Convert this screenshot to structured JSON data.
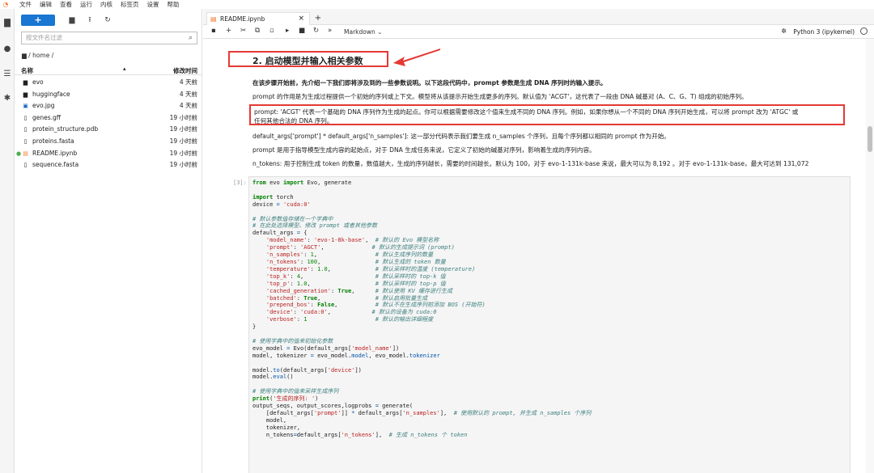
{
  "menubar": {
    "items": [
      "文件",
      "编辑",
      "查看",
      "运行",
      "内核",
      "标签页",
      "设置",
      "帮助"
    ]
  },
  "sidebar_icons": [
    "folder-icon",
    "running-icon",
    "toc-icon",
    "extension-icon"
  ],
  "file_browser": {
    "new_label": "+",
    "filter_placeholder": "按文件名过滤",
    "breadcrumb": "/ home /",
    "col_name": "名称",
    "col_modified": "修改时间",
    "files": [
      {
        "name": "evo",
        "modified": "4 天前",
        "icon": "folder-icon"
      },
      {
        "name": "huggingface",
        "modified": "4 天前",
        "icon": "folder-icon"
      },
      {
        "name": "evo.jpg",
        "modified": "4 天前",
        "icon": "image-icon"
      },
      {
        "name": "genes.gff",
        "modified": "19 小时前",
        "icon": "file-icon"
      },
      {
        "name": "protein_structure.pdb",
        "modified": "19 小时前",
        "icon": "file-icon"
      },
      {
        "name": "proteins.fasta",
        "modified": "19 小时前",
        "icon": "file-icon"
      },
      {
        "name": "README.ipynb",
        "modified": "19 小时前",
        "icon": "notebook-icon"
      },
      {
        "name": "sequence.fasta",
        "modified": "19 小时前",
        "icon": "file-icon"
      }
    ]
  },
  "tab": {
    "title": "README.ipynb"
  },
  "toolbar": {
    "cell_type": "Markdown",
    "kernel": "Python 3 (ipykernel)"
  },
  "notebook": {
    "heading": "2. 启动模型并输入相关参数",
    "p1": "在该步骤开始前，先介绍一下我们即将涉及到的一些参数说明。以下这段代码中，prompt 参数是生成 DNA 序列时的输入提示。",
    "p2": "prompt 的作用是为生成过程提供一个初始的序列或上下文。模型将从该提示开始生成更多的序列。默认值为 'ACGT'，这代表了一段由 DNA 碱基对 (A、C、G、T) 组成的初始序列。",
    "p3a": "prompt: 'ACGT' 代表一个基础的 DNA 序列作为生成的起点。你可以根据需要修改这个值来生成不同的 DNA 序列。例如，如果你想从一个不同的 DNA 序列开始生成，可以将 prompt 改为 'ATGC' 或",
    "p3b": "任何其他合法的 DNA 序列。",
    "p4": "default_args['prompt'] * default_args['n_samples']: 这一部分代码表示我们要生成 n_samples 个序列，且每个序列都以相同的 prompt 作为开始。",
    "p5": "prompt 是用于指导模型生成内容的起始点，对于 DNA 生成任务来说，它定义了初始的碱基对序列，影响着生成的序列内容。",
    "p6": "n_tokens: 用于控制生成 token 的数量，数值越大，生成的序列越长，需要的时间越长。默认为 100，对于 evo-1-131k-base 来说，最大可以为 8,192 。对于 evo-1-131k-base，最大可达到 131,072",
    "cell_prompt": "[3]:"
  }
}
